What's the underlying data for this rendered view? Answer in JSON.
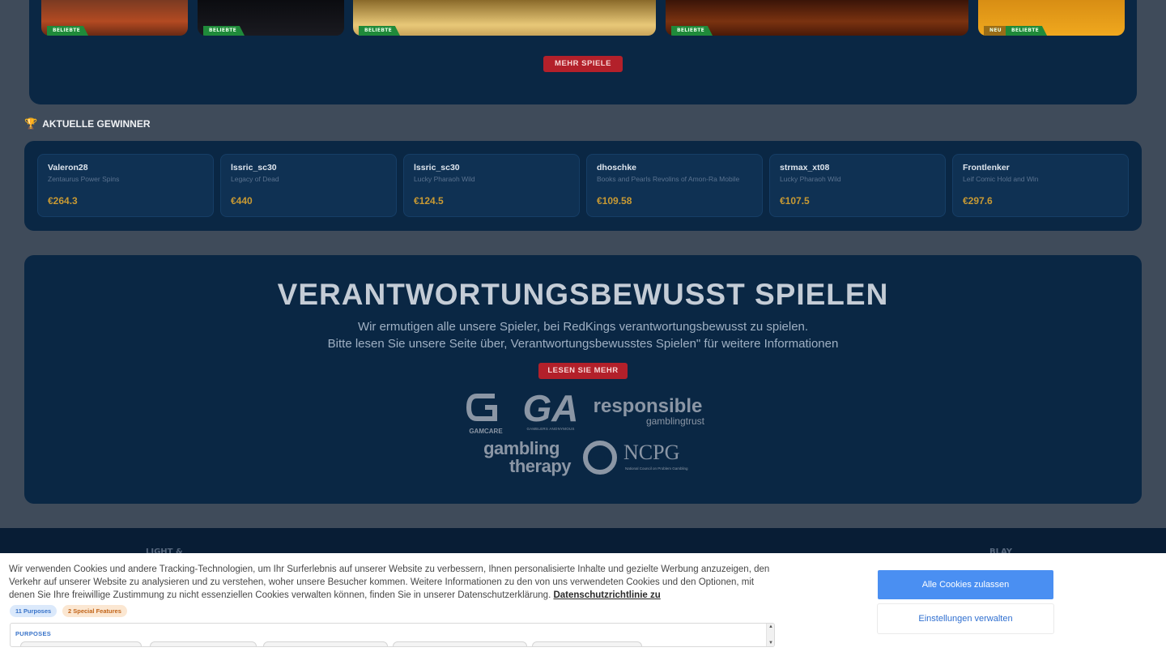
{
  "games": {
    "more_label": "MEHR SPIELE",
    "tiles": [
      {
        "badges": [
          "BELIEBTE"
        ],
        "color_top": "#7a3a22",
        "color_bottom": "#b34a22"
      },
      {
        "badges": [
          "BELIEBTE"
        ],
        "color_top": "#0b0c10",
        "color_bottom": "#16161a"
      },
      {
        "badges": [
          "BELIEBTE"
        ],
        "color_top": "#8a6a2a",
        "color_bottom": "#e8c878"
      },
      {
        "badges": [
          "BELIEBTE"
        ],
        "color_top": "#3a1408",
        "color_bottom": "#7a3210"
      },
      {
        "badges": [
          "NEU",
          "BELIEBTE"
        ],
        "color_top": "#d88e14",
        "color_bottom": "#f0a81e"
      }
    ]
  },
  "winners": {
    "title": "AKTUELLE GEWINNER",
    "items": [
      {
        "name": "Valeron28",
        "game": "Zentaurus Power Spins",
        "amount": "€264.3"
      },
      {
        "name": "lssric_sc30",
        "game": "Legacy of Dead",
        "amount": "€440"
      },
      {
        "name": "lssric_sc30",
        "game": "Lucky Pharaoh Wild",
        "amount": "€124.5"
      },
      {
        "name": "dhoschke",
        "game": "Books and Pearls Revolins of Amon-Ra Mobile",
        "amount": "€109.58"
      },
      {
        "name": "strmax_xt08",
        "game": "Lucky Pharaoh Wild",
        "amount": "€107.5"
      },
      {
        "name": "Frontlenker",
        "game": "Leif Comic Hold and Win",
        "amount": "€297.6"
      }
    ]
  },
  "responsible": {
    "title": "VERANTWORTUNGSBEWUSST SPIELEN",
    "line1": "Wir ermutigen alle unsere Spieler, bei  RedKings verantwortungsbewusst zu spielen.",
    "line2": "Bitte lesen Sie unsere Seite über, Verantwortungsbewusstes Spielen\" für weitere Informationen",
    "button": "LESEN SIE MEHR",
    "logos": {
      "gamcare": "GAMCARE",
      "ga": "GA",
      "ga_sub": "GAMBLERS ANONYMOUS",
      "rgt_main": "responsible",
      "rgt_sub": "gamblingtrust",
      "gt_line1": "gambling",
      "gt_line2": "therapy",
      "ncpg": "NCPG",
      "ncpg_sub": "National Council on Problem Gambling"
    }
  },
  "footer": {
    "marks": [
      "LIGHT &",
      "BLAY"
    ]
  },
  "cookie": {
    "text": "Wir verwenden Cookies und andere Tracking-Technologien, um Ihr Surferlebnis auf unserer Website zu verbessern, Ihnen personalisierte Inhalte und gezielte Werbung anzuzeigen, den Verkehr auf unserer Website zu analysieren und zu verstehen, woher unsere Besucher kommen. Weitere Informationen zu den von uns verwendeten Cookies und den Optionen, mit denen Sie Ihre freiwillige Zustimmung zu nicht essenziellen Cookies verwalten können, finden Sie in unserer Datenschutzerklärung.",
    "link": "Datenschutzrichtlinie zu",
    "purposes_chip": "11 Purposes",
    "features_chip": "2 Special Features",
    "purposes_heading": "PURPOSES",
    "accept_all": "Alle Cookies zulassen",
    "manage": "Einstellungen verwalten"
  }
}
